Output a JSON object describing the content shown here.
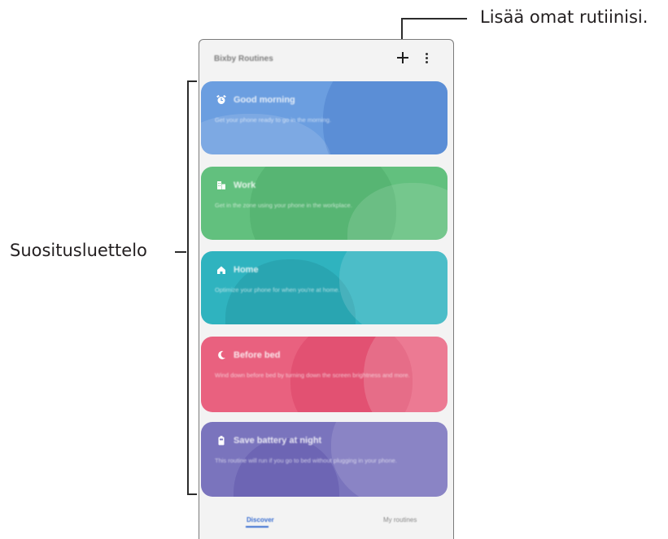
{
  "annotations": {
    "add_routine_label": "Lisää omat rutiinisi.",
    "recommendation_list_label": "Suositusluettelo"
  },
  "app": {
    "title": "Bixby Routines",
    "add_icon": "plus-icon",
    "more_icon": "more-vertical-icon"
  },
  "routines": [
    {
      "title": "Good morning",
      "description": "Get your phone ready to go in the morning.",
      "icon": "alarm-clock-icon",
      "color": "#6b9ee0"
    },
    {
      "title": "Work",
      "description": "Get in the zone using your phone in the workplace.",
      "icon": "building-icon",
      "color": "#62c07e"
    },
    {
      "title": "Home",
      "description": "Optimize your phone for when you're at home.",
      "icon": "home-icon",
      "color": "#2fb3bf"
    },
    {
      "title": "Before bed",
      "description": "Wind down before bed by turning down the screen brightness and more.",
      "icon": "moon-icon",
      "color": "#e9617f"
    },
    {
      "title": "Save battery at night",
      "description": "This routine will run if you go to bed without plugging in your phone.",
      "icon": "battery-icon",
      "color": "#7a74bd"
    }
  ],
  "tabs": {
    "discover": "Discover",
    "my_routines": "My routines"
  }
}
